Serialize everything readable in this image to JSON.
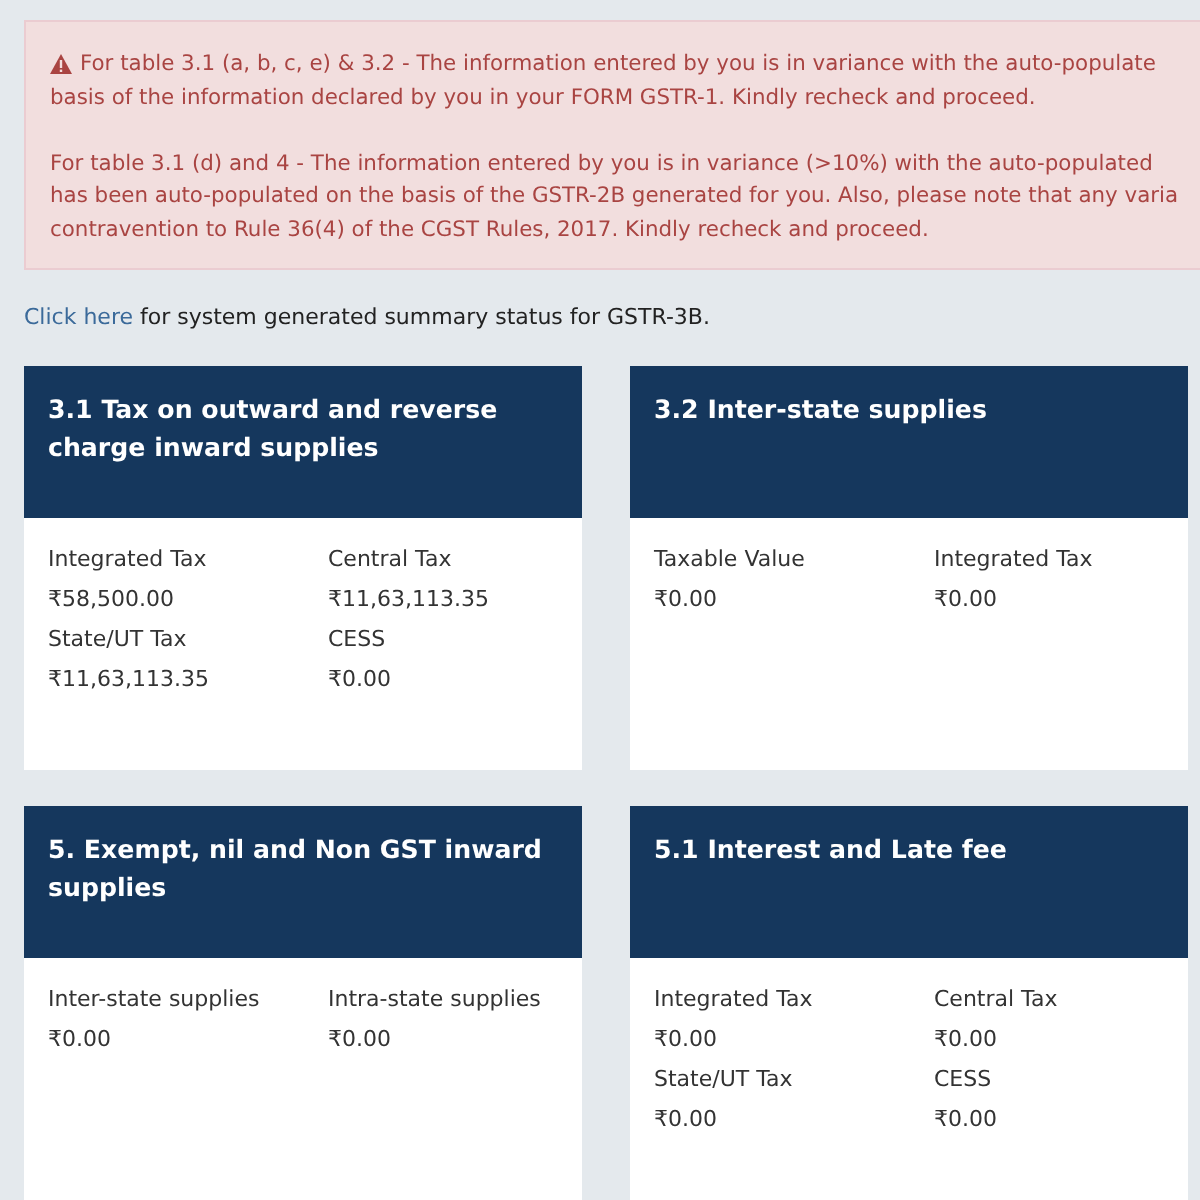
{
  "alert": {
    "paragraphs": [
      {
        "kind": "warning",
        "lines": [
          "For table 3.1 (a, b, c, e) & 3.2 - The information entered by you is in variance with the auto-populate",
          "basis of the information declared by you in your FORM GSTR-1. Kindly recheck and proceed."
        ]
      },
      {
        "kind": "plain",
        "lines": [
          "For table 3.1 (d) and 4 - The information entered by you is in variance (>10%) with the auto-populated",
          "has been auto-populated on the basis of the GSTR-2B generated for you. Also, please note that any varia",
          "contravention to Rule 36(4) of the CGST Rules, 2017. Kindly recheck and proceed."
        ]
      }
    ]
  },
  "summary_link": {
    "link": "Click here",
    "text": "for system generated summary status for GSTR-3B."
  },
  "cards": [
    {
      "title": "3.1 Tax on outward and reverse charge inward supplies",
      "fields": [
        {
          "label": "Integrated Tax",
          "value": "₹58,500.00"
        },
        {
          "label": "Central Tax",
          "value": "₹11,63,113.35"
        },
        {
          "label": "State/UT Tax",
          "value": "₹11,63,113.35"
        },
        {
          "label": "CESS",
          "value": "₹0.00"
        }
      ]
    },
    {
      "title": "3.2 Inter-state supplies",
      "fields": [
        {
          "label": "Taxable Value",
          "value": "₹0.00"
        },
        {
          "label": "Integrated Tax",
          "value": "₹0.00"
        }
      ]
    },
    {
      "title": "5. Exempt, nil and Non GST inward supplies",
      "fields": [
        {
          "label": "Inter-state supplies",
          "value": "₹0.00"
        },
        {
          "label": "Intra-state supplies",
          "value": "₹0.00"
        }
      ]
    },
    {
      "title": "5.1 Interest and Late fee",
      "fields": [
        {
          "label": "Integrated Tax",
          "value": "₹0.00"
        },
        {
          "label": "Central Tax",
          "value": "₹0.00"
        },
        {
          "label": "State/UT Tax",
          "value": "₹0.00"
        },
        {
          "label": "CESS",
          "value": "₹0.00"
        }
      ]
    }
  ]
}
